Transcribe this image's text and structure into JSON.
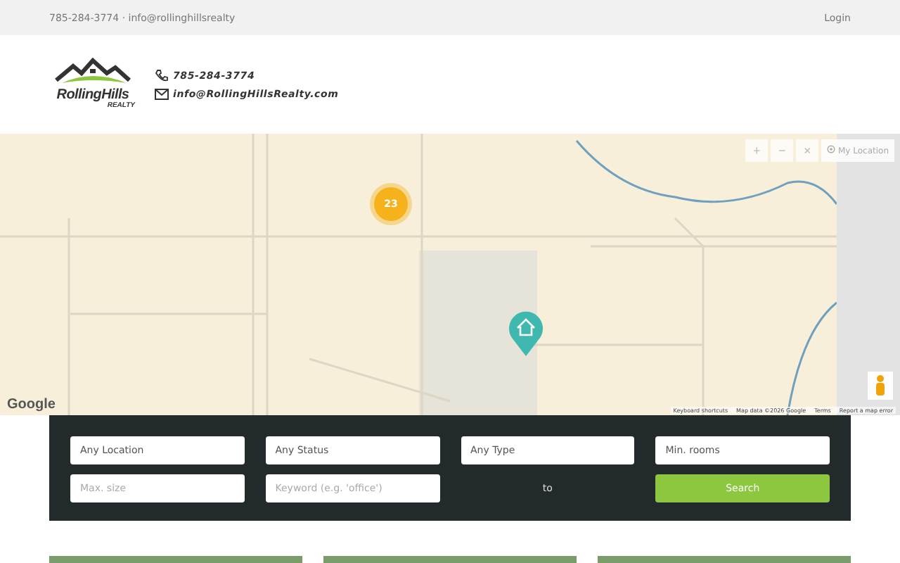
{
  "top_bar": {
    "contact": "785-284-3774 · info@rollinghillsrealty",
    "login": "Login"
  },
  "header": {
    "logo": {
      "name": "RollingHills",
      "tagline": "REALTY"
    },
    "phone": "785-284-3774",
    "email": "info@RollingHillsRealty.com"
  },
  "map": {
    "cluster_count": "23",
    "controls": [
      "+",
      "−",
      "×"
    ],
    "my_location": "My Location",
    "logo": "Google",
    "attribution": [
      "Keyboard shortcuts",
      "Map data ©2026 Google",
      "Terms",
      "Report a map error"
    ]
  },
  "search": {
    "fields": [
      {
        "kind": "select",
        "value": "Any Location"
      },
      {
        "kind": "select",
        "value": "Any Status"
      },
      {
        "kind": "select",
        "value": "Any Type"
      },
      {
        "kind": "select",
        "value": "Min. rooms"
      },
      {
        "kind": "input",
        "placeholder": "Max. size"
      },
      {
        "kind": "input",
        "placeholder": "Keyword (e.g. 'office')"
      },
      {
        "kind": "label",
        "text": "to"
      },
      {
        "kind": "button",
        "label": "Search"
      }
    ]
  },
  "listings": [
    {
      "kind": "photo"
    },
    {
      "kind": "photo"
    },
    {
      "kind": "photo"
    }
  ]
}
